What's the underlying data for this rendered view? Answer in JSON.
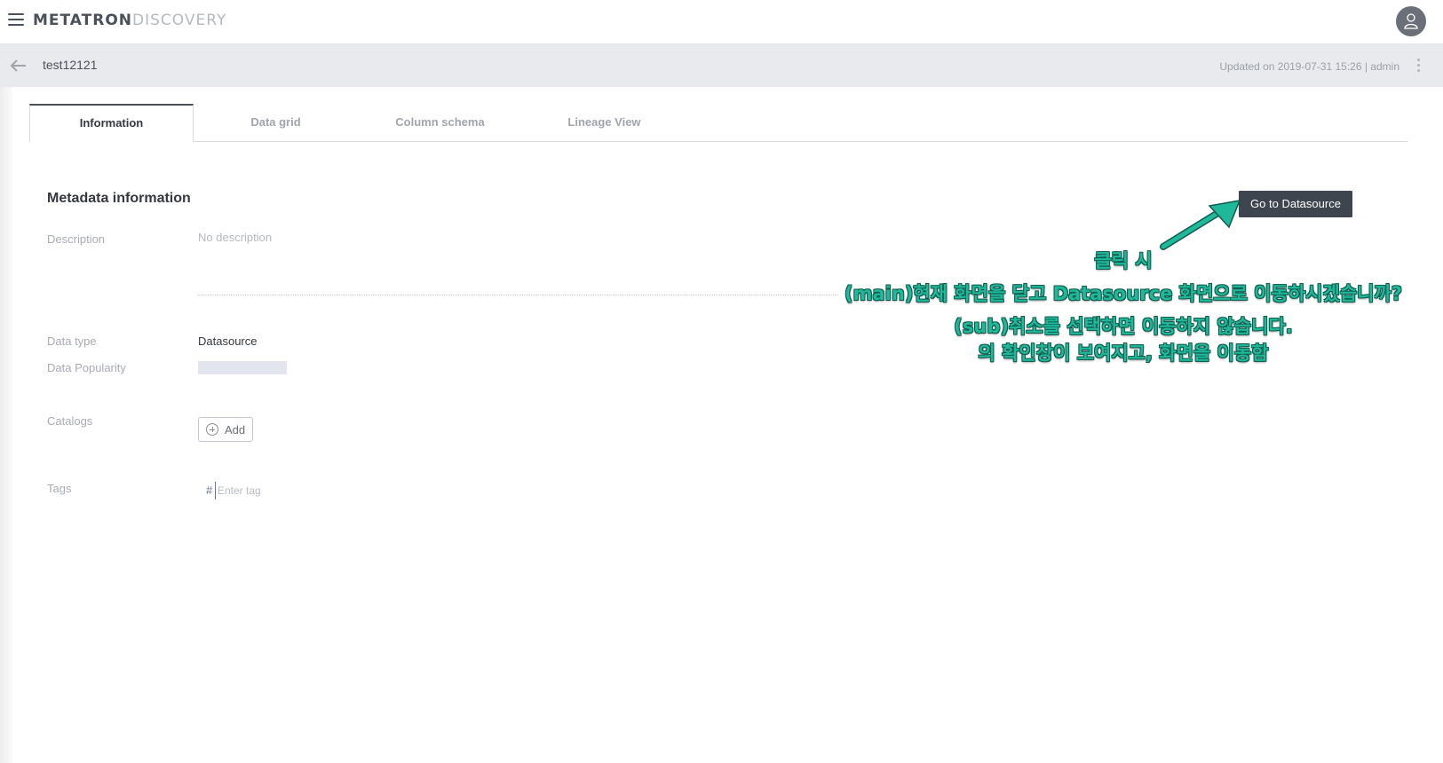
{
  "app": {
    "logo_primary": "METATRON",
    "logo_secondary": "DISCOVERY"
  },
  "header": {
    "title": "test12121",
    "updated": "Updated on 2019-07-31 15:26 | admin"
  },
  "tabs": [
    {
      "label": "Information",
      "active": true
    },
    {
      "label": "Data grid",
      "active": false
    },
    {
      "label": "Column schema",
      "active": false
    },
    {
      "label": "Lineage View",
      "active": false
    }
  ],
  "metadata": {
    "section_title": "Metadata information",
    "description_label": "Description",
    "description_value": "No description",
    "datatype_label": "Data type",
    "datatype_value": "Datasource",
    "popularity_label": "Data Popularity",
    "catalogs_label": "Catalogs",
    "add_label": "Add",
    "tags_label": "Tags",
    "tag_hash": "#",
    "tag_placeholder": "Enter tag"
  },
  "actions": {
    "go_label": "Go to Datasource"
  },
  "annotation": {
    "line1": "클릭 시",
    "line2": "(main)현재 화면을 닫고 Datasource 화면으로 이동하시겠습니까?",
    "line3": "(sub)취소를 선택하면 이동하지 않습니다.",
    "line4": "의 확인창이 보여지고, 화면을 이동함",
    "color": "#1fb89a"
  },
  "colors": {
    "accent": "#4b515b",
    "button_dark": "#3f454f",
    "subheader_bg": "#e9eaee"
  }
}
